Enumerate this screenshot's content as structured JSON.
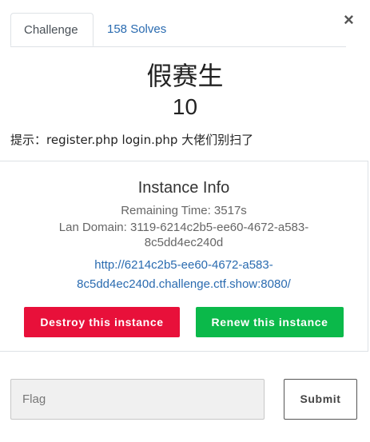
{
  "tabs": {
    "challenge": "Challenge",
    "solves": "158 Solves"
  },
  "close_symbol": "×",
  "challenge": {
    "name": "假赛生",
    "points": "10",
    "hint": "提示：register.php login.php 大佬们别扫了"
  },
  "instance": {
    "title": "Instance Info",
    "remaining_time": "Remaining Time: 3517s",
    "lan_domain_1": "Lan Domain: 3119-6214c2b5-ee60-4672-a583-",
    "lan_domain_2": "8c5dd4ec240d",
    "url_1": "http://6214c2b5-ee60-4672-a583-",
    "url_2": "8c5dd4ec240d.challenge.ctf.show:8080/",
    "destroy_label": "Destroy this instance",
    "renew_label": "Renew this instance"
  },
  "flag_form": {
    "placeholder": "Flag",
    "submit_label": "Submit"
  },
  "colors": {
    "link": "#2a6bb0",
    "destroy": "#e8103a",
    "renew": "#0bb94a"
  }
}
